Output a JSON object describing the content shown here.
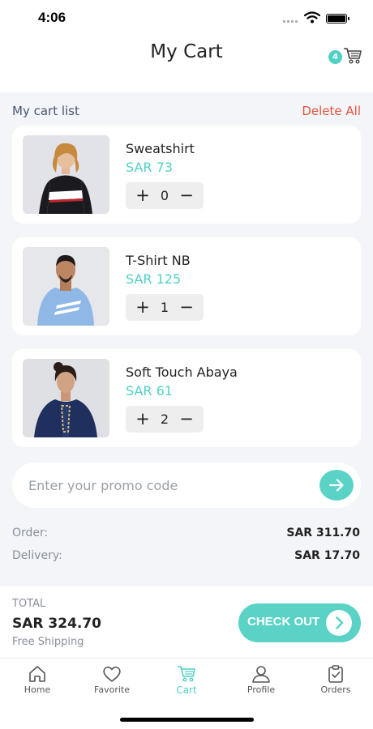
{
  "status_bar": {
    "time": "4:06"
  },
  "header": {
    "title": "My Cart",
    "cart_count": "4"
  },
  "cart": {
    "list_label": "My cart list",
    "delete_all": "Delete All",
    "items": [
      {
        "name": "Sweatshirt",
        "price": "SAR 73",
        "quantity": "0"
      },
      {
        "name": "T-Shirt NB",
        "price": "SAR 125",
        "quantity": "1"
      },
      {
        "name": "Soft Touch Abaya",
        "price": "SAR 61",
        "quantity": "2"
      }
    ]
  },
  "promo": {
    "placeholder": "Enter your promo code"
  },
  "summary": {
    "order_label": "Order:",
    "order_value": "SAR 311.70",
    "delivery_label": "Delivery:",
    "delivery_value": "SAR 17.70"
  },
  "checkout": {
    "total_label": "TOTAL",
    "total_value": "SAR 324.70",
    "shipping_note": "Free Shipping",
    "button_label": "CHECK OUT"
  },
  "tabs": [
    {
      "label": "Home",
      "icon": "home-icon"
    },
    {
      "label": "Favorite",
      "icon": "heart-icon"
    },
    {
      "label": "Cart",
      "icon": "cart-icon"
    },
    {
      "label": "Profile",
      "icon": "user-icon"
    },
    {
      "label": "Orders",
      "icon": "clipboard-icon"
    }
  ],
  "colors": {
    "accent": "#4fd1c5",
    "danger": "#e5533d",
    "background": "#f4f5f9"
  }
}
